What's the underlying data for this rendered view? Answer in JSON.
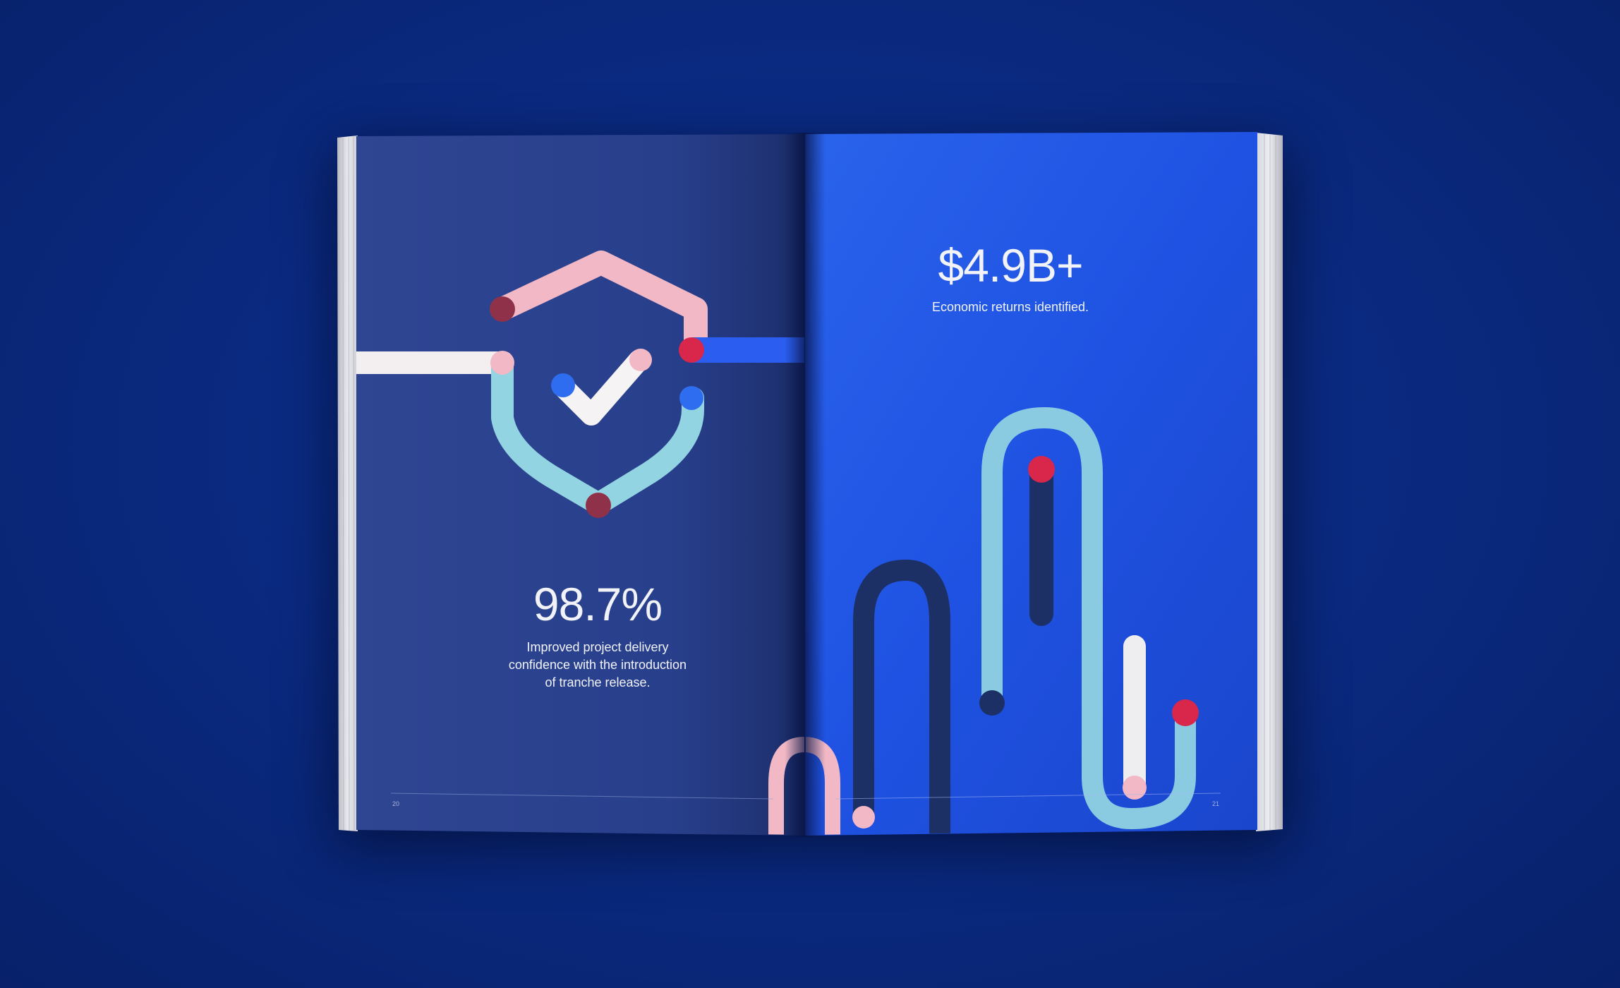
{
  "left_page": {
    "stat_value": "98.7%",
    "stat_caption_lines": [
      "Improved project delivery",
      "confidence with the introduction",
      "of tranche release."
    ],
    "page_number": "20",
    "illustration_icon": "shield-check-icon"
  },
  "right_page": {
    "stat_value": "$4.9B+",
    "stat_caption": "Economic returns identified.",
    "page_number": "21"
  },
  "colors": {
    "background": "#0a2a82",
    "left_page": "#283f8e",
    "right_page": "#1d4fe0",
    "pink": "#f2b7c4",
    "light_blue": "#93d4e3",
    "red": "#d62a4a",
    "navy": "#1b2f66",
    "white": "#f3f1f2"
  }
}
